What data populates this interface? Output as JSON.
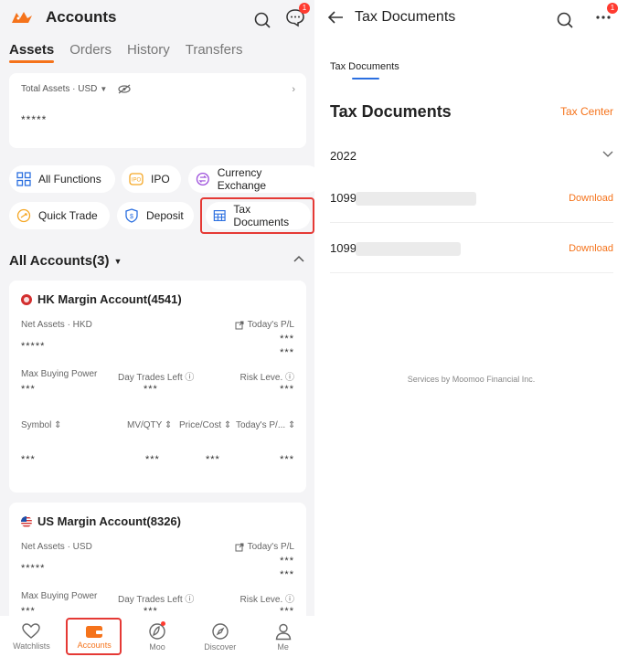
{
  "left": {
    "title": "Accounts",
    "notification_badge": "1",
    "tabs": [
      "Assets",
      "Orders",
      "History",
      "Transfers"
    ],
    "assets_card": {
      "label": "Total Assets · USD",
      "value": "*****"
    },
    "functions": [
      {
        "label": "All Functions",
        "icon": "grid-icon"
      },
      {
        "label": "IPO",
        "icon": "ipo-icon"
      },
      {
        "label": "Currency Exchange",
        "icon": "currency-exchange-icon"
      },
      {
        "label": "Quick Trade",
        "icon": "quick-trade-icon"
      },
      {
        "label": "Deposit",
        "icon": "deposit-icon"
      },
      {
        "label": "Tax Documents",
        "icon": "table-icon"
      }
    ],
    "all_accounts": "All Accounts(3)",
    "accounts": [
      {
        "name": "HK Margin Account(4541)",
        "flag_color": "#d32f2f",
        "net_assets_label": "Net Assets · HKD",
        "net_assets_value": "*****",
        "pl_label": "Today's P/L",
        "pl_value1": "***",
        "pl_value2": "***",
        "max_bp_label": "Max Buying Power",
        "max_bp_value": "***",
        "dtl_label": "Day Trades Left",
        "dtl_value": "***",
        "risk_label": "Risk Leve.",
        "risk_value": "***",
        "columns": [
          "Symbol",
          "MV/QTY",
          "Price/Cost",
          "Today's P/..."
        ],
        "row_values": [
          "***",
          "***",
          "***",
          "***"
        ]
      },
      {
        "name": "US Margin Account(8326)",
        "flag_color": "#1e4fa8",
        "net_assets_label": "Net Assets · USD",
        "net_assets_value": "*****",
        "pl_label": "Today's P/L",
        "pl_value1": "***",
        "pl_value2": "***",
        "max_bp_label": "Max Buying Power",
        "max_bp_value": "***",
        "dtl_label": "Day Trades Left",
        "dtl_value": "***",
        "risk_label": "Risk Leve.",
        "risk_value": "***"
      }
    ],
    "tabbar": [
      {
        "label": "Watchlists",
        "icon": "heart-icon"
      },
      {
        "label": "Accounts",
        "icon": "wallet-icon"
      },
      {
        "label": "Moo",
        "icon": "moo-icon"
      },
      {
        "label": "Discover",
        "icon": "compass-icon"
      },
      {
        "label": "Me",
        "icon": "person-icon"
      }
    ]
  },
  "right": {
    "title": "Tax Documents",
    "notification_badge": "1",
    "tab": "Tax Documents",
    "heading": "Tax Documents",
    "tax_center": "Tax Center",
    "year": "2022",
    "documents": [
      {
        "name": "1099",
        "action": "Download"
      },
      {
        "name": "1099",
        "action": "Download"
      }
    ],
    "footer": "Services by Moomoo Financial Inc."
  },
  "colors": {
    "accent": "#f5731b",
    "highlight": "#e53935",
    "tab_underline": "#2b6fe0"
  }
}
